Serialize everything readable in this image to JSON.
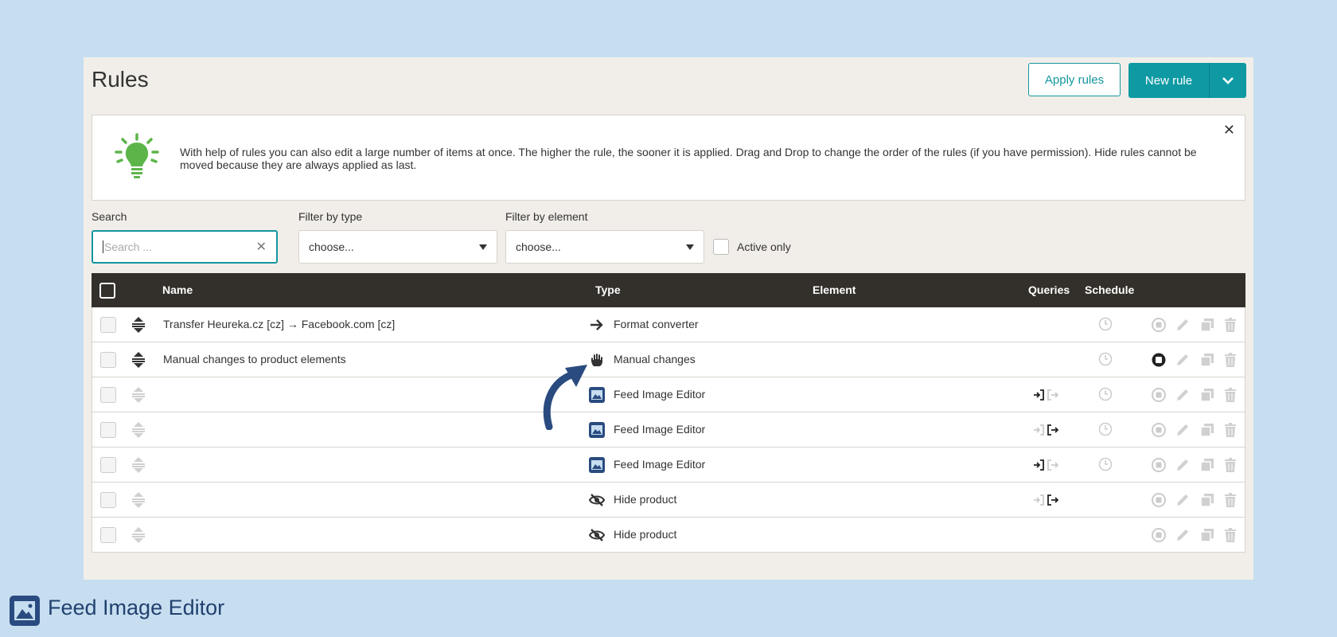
{
  "page": {
    "title": "Rules"
  },
  "toolbar": {
    "apply_label": "Apply rules",
    "new_label": "New rule"
  },
  "info": {
    "text": "With help of rules you can also edit a large number of items at once. The higher the rule, the sooner it is applied. Drag and Drop to change the order of the rules (if you have permission). Hide rules cannot be moved because they are always applied as last."
  },
  "filters": {
    "search_label": "Search",
    "search_placeholder": "Search ...",
    "type_label": "Filter by type",
    "type_value": "choose...",
    "element_label": "Filter by element",
    "element_value": "choose...",
    "active_only_label": "Active only"
  },
  "table": {
    "headers": {
      "name": "Name",
      "type": "Type",
      "element": "Element",
      "queries": "Queries",
      "schedule": "Schedule"
    },
    "rows": [
      {
        "name": "Transfer Heureka.cz [cz] → Facebook.com [cz]",
        "type": "Format converter",
        "type_icon": "arrow-right-icon",
        "queries": "none",
        "schedule": true,
        "active": false,
        "draggable": true
      },
      {
        "name": "Manual changes to product elements",
        "type": "Manual changes",
        "type_icon": "hand-icon",
        "queries": "none",
        "schedule": true,
        "active": true,
        "draggable": true
      },
      {
        "name": "",
        "type": "Feed Image Editor",
        "type_icon": "image-icon",
        "queries": "in",
        "schedule": true,
        "active": false,
        "draggable": false
      },
      {
        "name": "",
        "type": "Feed Image Editor",
        "type_icon": "image-icon",
        "queries": "out",
        "schedule": true,
        "active": false,
        "draggable": false
      },
      {
        "name": "",
        "type": "Feed Image Editor",
        "type_icon": "image-icon",
        "queries": "in",
        "schedule": true,
        "active": false,
        "draggable": false
      },
      {
        "name": "",
        "type": "Hide product",
        "type_icon": "eye-off-icon",
        "queries": "out",
        "schedule": false,
        "active": false,
        "draggable": false
      },
      {
        "name": "",
        "type": "Hide product",
        "type_icon": "eye-off-icon",
        "queries": "none",
        "schedule": false,
        "active": false,
        "draggable": false
      }
    ]
  },
  "footer": {
    "label": "Feed Image Editor"
  },
  "colors": {
    "accent": "#0f9aa3",
    "header_bg": "#33302c",
    "panel_bg": "#f1eee9",
    "page_bg": "#c7def1",
    "footer_text": "#22416f",
    "bulb": "#5db54a"
  }
}
